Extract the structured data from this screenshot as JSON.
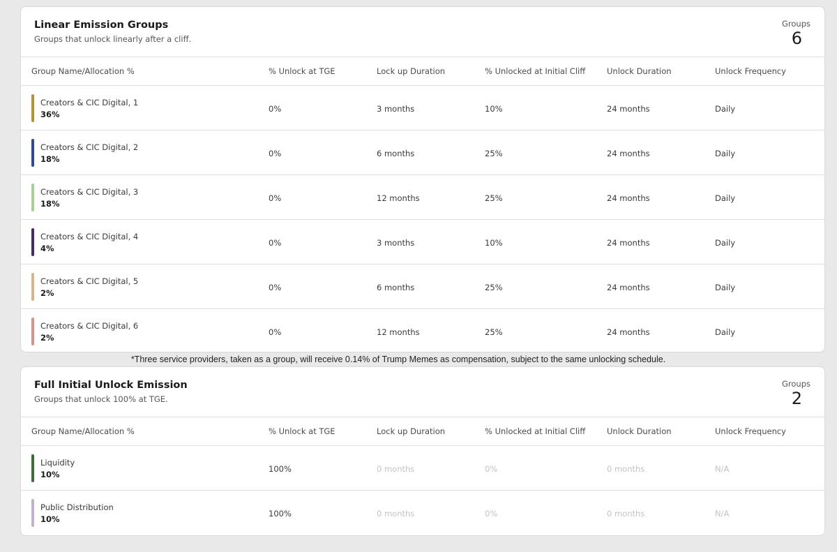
{
  "linear": {
    "title": "Linear Emission Groups",
    "subtitle": "Groups that unlock linearly after a cliff.",
    "groups_label": "Groups",
    "groups_count": "6",
    "columns": [
      "Group Name/Allocation %",
      "% Unlock at TGE",
      "Lock up Duration",
      "% Unlocked at Initial Cliff",
      "Unlock Duration",
      "Unlock Frequency"
    ],
    "rows": [
      {
        "name": "Creators & CIC Digital, 1",
        "pct": "36%",
        "color": "#b8913c",
        "tge": "0%",
        "lockup": "3 months",
        "cliff": "10%",
        "duration": "24 months",
        "frequency": "Daily"
      },
      {
        "name": "Creators & CIC Digital, 2",
        "pct": "18%",
        "color": "#2f4a8f",
        "tge": "0%",
        "lockup": "6 months",
        "cliff": "25%",
        "duration": "24 months",
        "frequency": "Daily"
      },
      {
        "name": "Creators & CIC Digital, 3",
        "pct": "18%",
        "color": "#a9cf93",
        "tge": "0%",
        "lockup": "12 months",
        "cliff": "25%",
        "duration": "24 months",
        "frequency": "Daily"
      },
      {
        "name": "Creators & CIC Digital, 4",
        "pct": "4%",
        "color": "#4a2a6b",
        "tge": "0%",
        "lockup": "3 months",
        "cliff": "10%",
        "duration": "24 months",
        "frequency": "Daily"
      },
      {
        "name": "Creators & CIC Digital, 5",
        "pct": "2%",
        "color": "#d9b48a",
        "tge": "0%",
        "lockup": "6 months",
        "cliff": "25%",
        "duration": "24 months",
        "frequency": "Daily"
      },
      {
        "name": "Creators & CIC Digital, 6",
        "pct": "2%",
        "color": "#d4948e",
        "tge": "0%",
        "lockup": "12 months",
        "cliff": "25%",
        "duration": "24 months",
        "frequency": "Daily"
      }
    ]
  },
  "footnote": "*Three service providers, taken as a group, will receive 0.14% of Trump Memes as compensation, subject to the same unlocking schedule.",
  "full": {
    "title": "Full Initial Unlock Emission",
    "subtitle": "Groups that unlock 100% at TGE.",
    "groups_label": "Groups",
    "groups_count": "2",
    "columns": [
      "Group Name/Allocation %",
      "% Unlock at TGE",
      "Lock up Duration",
      "% Unlocked at Initial Cliff",
      "Unlock Duration",
      "Unlock Frequency"
    ],
    "rows": [
      {
        "name": "Liquidity",
        "pct": "10%",
        "color": "#3f6a3a",
        "tge": "100%",
        "lockup": "0 months",
        "cliff": "0%",
        "duration": "0 months",
        "frequency": "N/A"
      },
      {
        "name": "Public Distribution",
        "pct": "10%",
        "color": "#c2b0d2",
        "tge": "100%",
        "lockup": "0 months",
        "cliff": "0%",
        "duration": "0 months",
        "frequency": "N/A"
      }
    ]
  }
}
